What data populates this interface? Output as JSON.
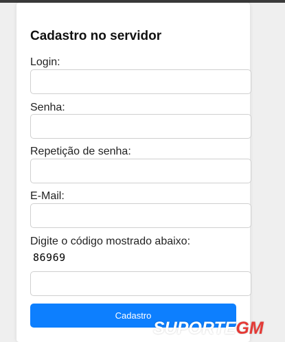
{
  "form": {
    "title": "Cadastro no servidor",
    "fields": [
      {
        "label": "Login:",
        "value": ""
      },
      {
        "label": "Senha:",
        "value": ""
      },
      {
        "label": "Repetição de senha:",
        "value": ""
      },
      {
        "label": "E-Mail:",
        "value": ""
      },
      {
        "label": "Digite o código mostrado abaixo:",
        "value": ""
      }
    ],
    "captcha_code": "86969",
    "submit_label": "Cadastro"
  },
  "watermark": {
    "part1": "SUPORTE",
    "part2": "GM"
  },
  "colors": {
    "accent": "#0d7ffe",
    "background": "#efefef",
    "card": "#ffffff"
  }
}
